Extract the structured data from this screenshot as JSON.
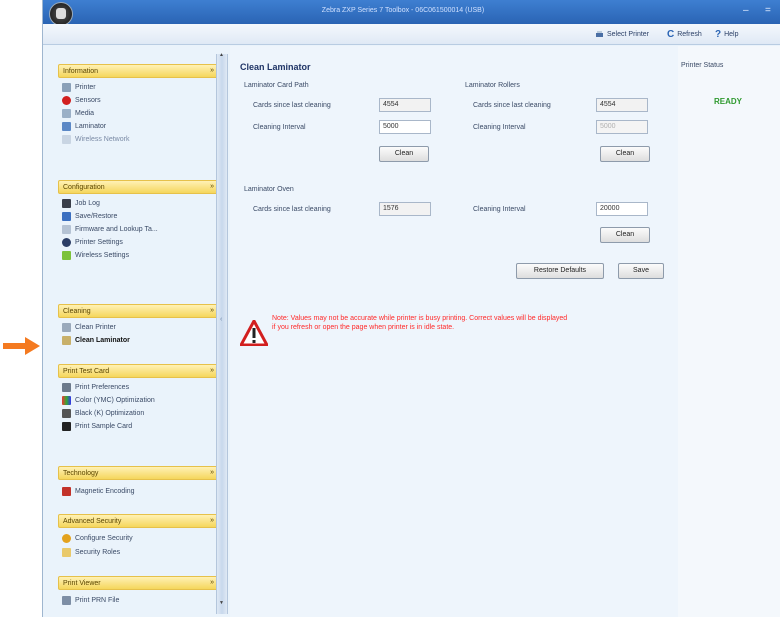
{
  "window": {
    "title": "Zebra ZXP Series 7 Toolbox - 06C061500014 (USB)"
  },
  "toolbar": {
    "select_printer": "Select Printer",
    "refresh": "Refresh",
    "help": "Help"
  },
  "sidebar": {
    "groups": [
      {
        "label": "Information",
        "items": [
          "Printer",
          "Sensors",
          "Media",
          "Laminator",
          "Wireless Network"
        ]
      },
      {
        "label": "Configuration",
        "items": [
          "Job Log",
          "Save/Restore",
          "Firmware and Lookup Ta...",
          "Printer Settings",
          "Wireless Settings"
        ]
      },
      {
        "label": "Cleaning",
        "items": [
          "Clean Printer",
          "Clean Laminator"
        ]
      },
      {
        "label": "Print Test Card",
        "items": [
          "Print Preferences",
          "Color (YMC) Optimization",
          "Black (K) Optimization",
          "Print Sample Card"
        ]
      },
      {
        "label": "Technology",
        "items": [
          "Magnetic Encoding"
        ]
      },
      {
        "label": "Advanced Security",
        "items": [
          "Configure Security",
          "Security Roles"
        ]
      },
      {
        "label": "Print Viewer",
        "items": [
          "Print PRN File"
        ]
      }
    ]
  },
  "main": {
    "title": "Clean Laminator",
    "card_path": {
      "label": "Laminator Card Path",
      "since_label": "Cards since last cleaning",
      "since_value": "4554",
      "interval_label": "Cleaning Interval",
      "interval_value": "5000",
      "clean_label": "Clean"
    },
    "rollers": {
      "label": "Laminator Rollers",
      "since_label": "Cards since last cleaning",
      "since_value": "4554",
      "interval_label": "Cleaning Interval",
      "interval_value": "5000",
      "clean_label": "Clean"
    },
    "oven": {
      "label": "Laminator Oven",
      "since_label": "Cards since last cleaning",
      "since_value": "1576",
      "interval_label": "Cleaning Interval",
      "interval_value": "20000",
      "clean_label": "Clean"
    },
    "restore_label": "Restore Defaults",
    "save_label": "Save",
    "note": "Note: Values may not be accurate while printer is busy printing. Correct values will be displayed if you refresh or open the page when printer is in idle state."
  },
  "status": {
    "title": "Printer Status",
    "value": "READY",
    "ready_color": "#2f9a2f"
  },
  "colors": {
    "titlebar": "#2a64b4",
    "group_header": "#f5d65c",
    "note": "#ff2a2a",
    "arrow": "#f47a20"
  }
}
